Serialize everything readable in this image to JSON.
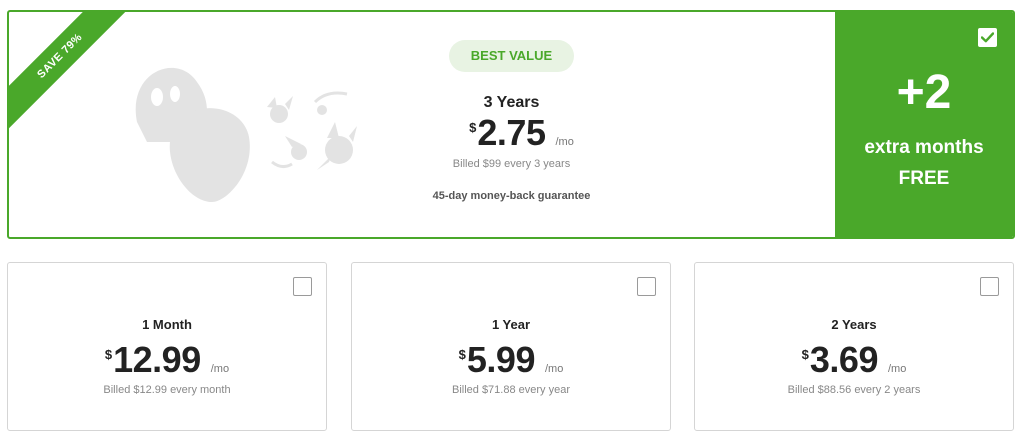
{
  "featured": {
    "ribbon": "SAVE 79%",
    "badge": "BEST VALUE",
    "plan": "3 Years",
    "currency": "$",
    "price": "2.75",
    "per": "/mo",
    "billed": "Billed $99 every 3 years",
    "guarantee": "45-day money-back guarantee",
    "selected": true,
    "bonus": {
      "big": "+2",
      "line1": "extra months",
      "line2": "FREE"
    }
  },
  "plans": [
    {
      "name": "1 Month",
      "currency": "$",
      "price": "12.99",
      "per": "/mo",
      "billed": "Billed $12.99 every month",
      "selected": false
    },
    {
      "name": "1 Year",
      "currency": "$",
      "price": "5.99",
      "per": "/mo",
      "billed": "Billed $71.88 every year",
      "selected": false
    },
    {
      "name": "2 Years",
      "currency": "$",
      "price": "3.69",
      "per": "/mo",
      "billed": "Billed $88.56 every 2 years",
      "selected": false
    }
  ],
  "colors": {
    "accent": "#4aa82a",
    "badge_bg": "#e8f3e3",
    "illustration": "#e3e3e3"
  },
  "icons": {
    "featured_checkbox": "checkmark-icon",
    "illustration": "ghost-mascot-illustration"
  }
}
